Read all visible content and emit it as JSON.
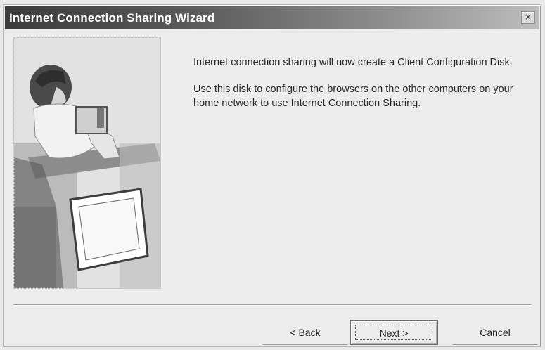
{
  "window": {
    "title": "Internet Connection Sharing Wizard",
    "close_glyph": "×"
  },
  "content": {
    "paragraph1": "Internet connection sharing will now create a Client Configuration Disk.",
    "paragraph2": "Use this disk to configure the browsers on the other computers on your home network to use Internet Connection Sharing."
  },
  "buttons": {
    "back": "< Back",
    "next": "Next >",
    "cancel": "Cancel"
  },
  "icons": {
    "wizard_illustration": "person-at-computer-illustration",
    "close": "close-icon"
  }
}
